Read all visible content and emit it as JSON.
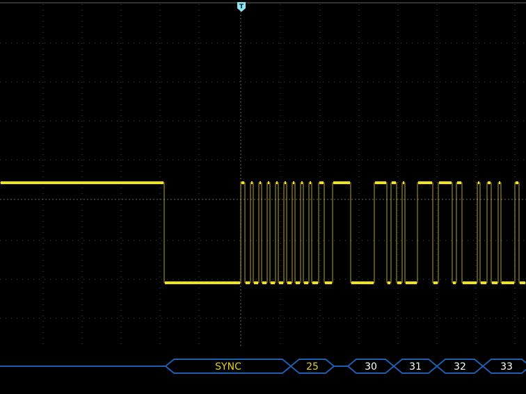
{
  "colors": {
    "background": "#000000",
    "trace": "#f2e21a",
    "grid": "#4a4a4a",
    "bus": "#1e5fb0",
    "bus_text_sync": "#e6d21a",
    "bus_text_data": "#ffffff",
    "trigger": "#8fe3f0"
  },
  "trigger": {
    "label": "T",
    "icon": "trigger-position-marker"
  },
  "decode_bus": {
    "frames": [
      {
        "label": "SYNC",
        "kind": "sync"
      },
      {
        "label": "25",
        "kind": "sync"
      },
      {
        "label": "30",
        "kind": "data"
      },
      {
        "label": "31",
        "kind": "data"
      },
      {
        "label": "32",
        "kind": "data"
      },
      {
        "label": "33",
        "kind": "data"
      }
    ]
  }
}
